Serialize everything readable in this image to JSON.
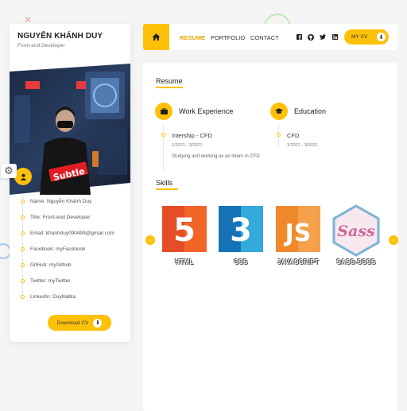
{
  "profile": {
    "name": "NGUYỄN KHÁNH DUY",
    "role": "Front-end Developer",
    "photo_sign": "Subtle",
    "info": [
      {
        "label": "Name:",
        "value": "Nguyễn Khánh Duy"
      },
      {
        "label": "Title:",
        "value": "Front-end Developer"
      },
      {
        "label": "Email:",
        "value": "khanhduy090499@gmail.com"
      },
      {
        "label": "Facebook:",
        "value": "myFacebook"
      },
      {
        "label": "GitHub:",
        "value": "myGithub"
      },
      {
        "label": "Twitter:",
        "value": "myTwitter"
      },
      {
        "label": "LinkedIn:",
        "value": "Duyblabla"
      }
    ],
    "download_label": "Download CV"
  },
  "nav": {
    "links": [
      "RESUME",
      "PORTFOLIO",
      "CONTACT"
    ],
    "active": "RESUME",
    "social": [
      "f",
      "gh",
      "tw",
      "in"
    ],
    "mycv_label": "MY CV"
  },
  "resume": {
    "title": "Resume",
    "experience": {
      "heading": "Work Experience",
      "items": [
        {
          "title": "Intership - CFD",
          "date": "1/2021 - 3/2021",
          "desc": "Studying and working as an intern in CFD"
        }
      ]
    },
    "education": {
      "heading": "Education",
      "items": [
        {
          "title": "CFD",
          "date": "1/2021 - 3/2021"
        }
      ]
    }
  },
  "skills": {
    "title": "Skills",
    "items": [
      {
        "name": "HTML",
        "glyph": "5",
        "color": "#e44d26"
      },
      {
        "name": "CSS",
        "glyph": "3",
        "color": "#1572b6"
      },
      {
        "name": "JAVASCRIPT",
        "glyph": "JS",
        "color": "#f0892c"
      },
      {
        "name": "SASS-SCSS",
        "glyph": "Sass",
        "color": "#cd6799"
      }
    ]
  },
  "colors": {
    "accent": "#ffc107",
    "background": "#f4f4f4"
  }
}
